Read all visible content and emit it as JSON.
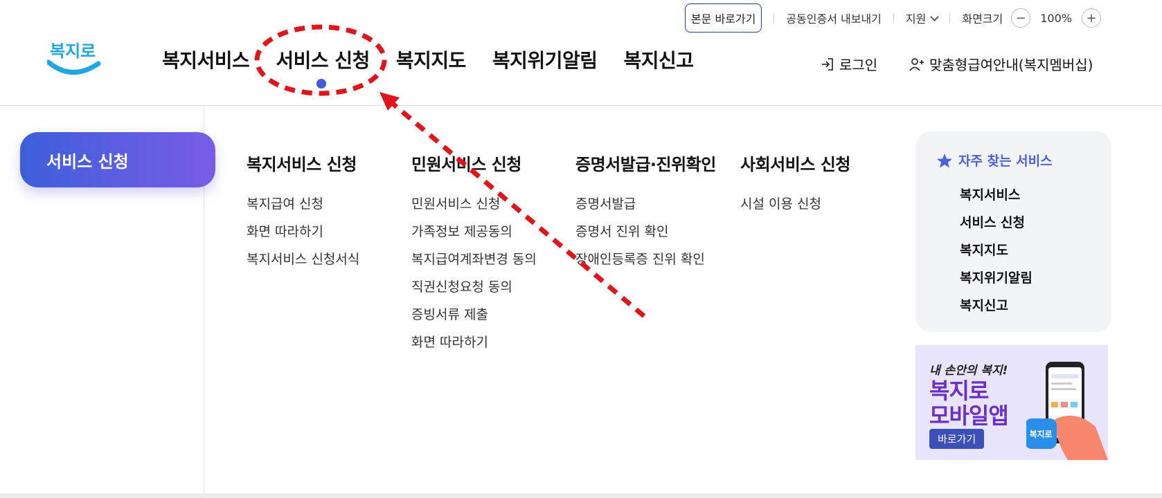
{
  "utility_bar": {
    "skip_to_content": "본문 바로가기",
    "cert_export": "공동인증서 내보내기",
    "support": "지원",
    "zoom_label": "화면크기",
    "zoom_minus": "−",
    "zoom_value": "100%",
    "zoom_plus": "+"
  },
  "logo_text": "복지로",
  "gnb": {
    "items": [
      "복지서비스",
      "서비스 신청",
      "복지지도",
      "복지위기알림",
      "복지신고"
    ],
    "active_index": 1
  },
  "header_right": {
    "login": "로그인",
    "membership": "맞춤형급여안내(복지멤버십)"
  },
  "side_title": "서비스 신청",
  "menu_columns": [
    {
      "title": "복지서비스 신청",
      "items": [
        "복지급여 신청",
        "화면 따라하기",
        "복지서비스 신청서식"
      ]
    },
    {
      "title": "민원서비스 신청",
      "items": [
        "민원서비스 신청",
        "가족정보 제공동의",
        "복지급여계좌변경 동의",
        "직권신청요청 동의",
        "증빙서류 제출",
        "화면 따라하기"
      ]
    },
    {
      "title": "증명서발급·진위확인",
      "items": [
        "증명서발급",
        "증명서 진위 확인",
        "장애인등록증 진위 확인"
      ]
    },
    {
      "title": "사회서비스 신청",
      "items": [
        "시설 이용 신청"
      ]
    }
  ],
  "favorites": {
    "title": "자주 찾는 서비스",
    "items": [
      "복지서비스",
      "서비스 신청",
      "복지지도",
      "복지위기알림",
      "복지신고"
    ]
  },
  "banner": {
    "tagline": "내 손안의 복지!",
    "title_line1": "복지로",
    "title_line2": "모바일앱",
    "button": "바로가기",
    "app_icon_text": "복지로"
  },
  "colors": {
    "accent_blue": "#3f5fd8",
    "gradient_start": "#3d5fdb",
    "gradient_end": "#7a5ce6",
    "annotation_red": "#e0151b",
    "banner_purple": "#6a2fc9"
  }
}
